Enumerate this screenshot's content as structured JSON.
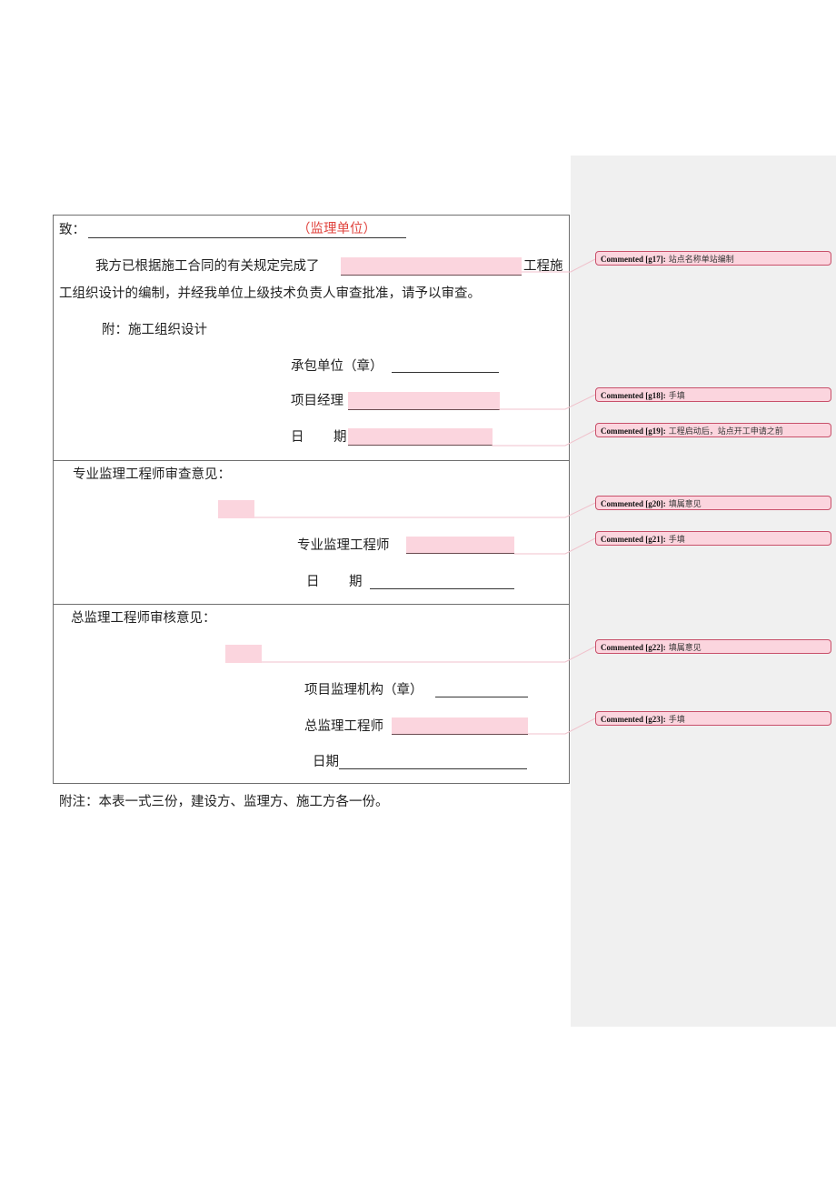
{
  "form": {
    "to_label": "致：",
    "to_placeholder": "（监理单位）",
    "para1_part1": "我方已根据施工合同的有关规定完成了",
    "para1_part2": "工程施",
    "para1_line2": "工组织设计的编制，并经我单位上级技术负责人审查批准，请予以审查。",
    "attach": "附：施工组织设计",
    "contractor_label": "承包单位（章）",
    "pm_label": "项目经理",
    "date1_label_a": "日",
    "date1_label_b": "期",
    "sec2_title": "专业监理工程师审查意见：",
    "sec2_engineer_label": "专业监理工程师",
    "date2_label_a": "日",
    "date2_label_b": "期",
    "sec3_title": "总监理工程师审核意见：",
    "sec3_org_label": "项目监理机构（章）",
    "sec3_chief_label": "总监理工程师",
    "date3_label": "日期"
  },
  "footnote": "附注：本表一式三份，建设方、监理方、施工方各一份。",
  "comments": [
    {
      "id": "Commented [g17]:",
      "text": "站点名称单站编制"
    },
    {
      "id": "Commented [g18]:",
      "text": "手填"
    },
    {
      "id": "Commented [g19]:",
      "text": "工程启动后，站点开工申请之前"
    },
    {
      "id": "Commented [g20]:",
      "text": "填属意见"
    },
    {
      "id": "Commented [g21]:",
      "text": "手填"
    },
    {
      "id": "Commented [g22]:",
      "text": "填属意见"
    },
    {
      "id": "Commented [g23]:",
      "text": "手填"
    }
  ],
  "colors": {
    "highlight": "#fbd5de",
    "comment_border": "#c8506a",
    "placeholder_red": "#e0453f",
    "pane_bg": "#f0f0f0"
  }
}
